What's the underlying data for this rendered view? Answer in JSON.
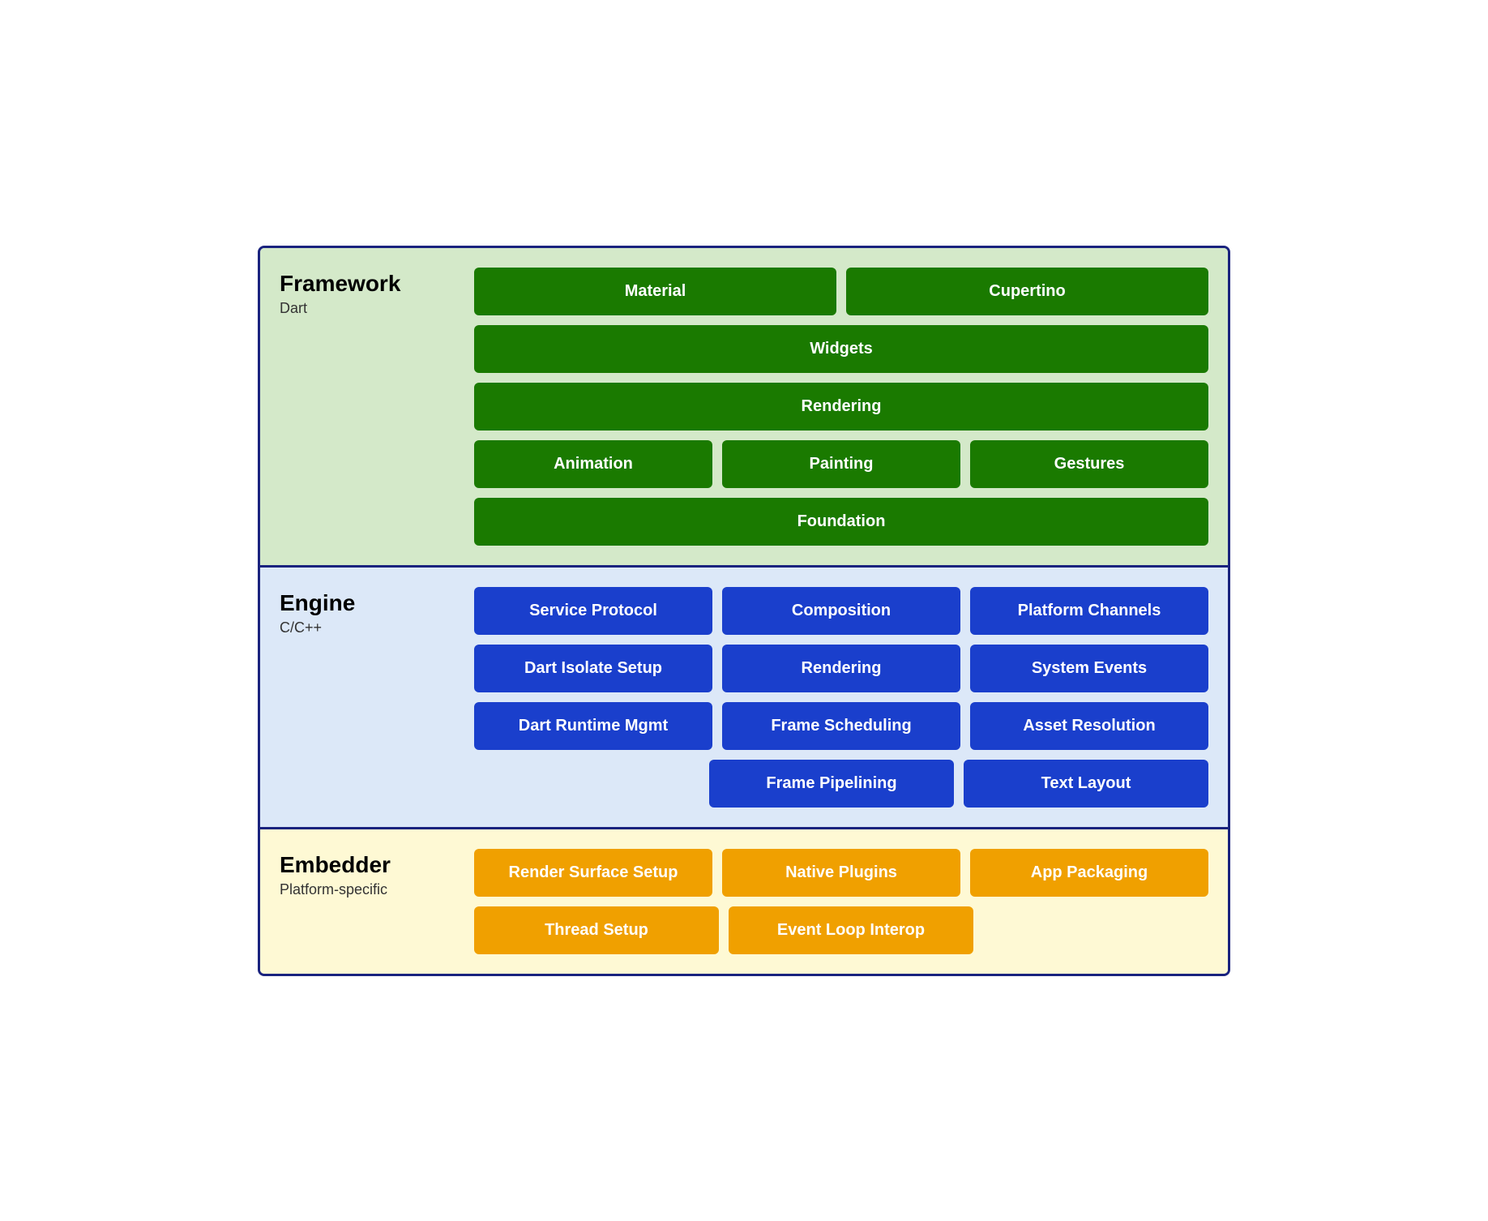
{
  "framework": {
    "title": "Framework",
    "subtitle": "Dart",
    "rows": [
      [
        {
          "label": "Material",
          "flex": 1
        },
        {
          "label": "Cupertino",
          "flex": 1
        }
      ],
      [
        {
          "label": "Widgets",
          "flex": 1
        }
      ],
      [
        {
          "label": "Rendering",
          "flex": 1
        }
      ],
      [
        {
          "label": "Animation",
          "flex": 1
        },
        {
          "label": "Painting",
          "flex": 1
        },
        {
          "label": "Gestures",
          "flex": 1
        }
      ],
      [
        {
          "label": "Foundation",
          "flex": 1
        }
      ]
    ]
  },
  "engine": {
    "title": "Engine",
    "subtitle": "C/C++",
    "rows": [
      [
        {
          "label": "Service Protocol",
          "flex": 1
        },
        {
          "label": "Composition",
          "flex": 1
        },
        {
          "label": "Platform Channels",
          "flex": 1
        }
      ],
      [
        {
          "label": "Dart Isolate Setup",
          "flex": 1
        },
        {
          "label": "Rendering",
          "flex": 1
        },
        {
          "label": "System Events",
          "flex": 1
        }
      ],
      [
        {
          "label": "Dart Runtime Mgmt",
          "flex": 1
        },
        {
          "label": "Frame Scheduling",
          "flex": 1
        },
        {
          "label": "Asset Resolution",
          "flex": 1
        }
      ],
      [
        {
          "label": "",
          "flex": 1,
          "empty": true
        },
        {
          "label": "Frame Pipelining",
          "flex": 1
        },
        {
          "label": "Text Layout",
          "flex": 1
        }
      ]
    ]
  },
  "embedder": {
    "title": "Embedder",
    "subtitle": "Platform-specific",
    "rows": [
      [
        {
          "label": "Render Surface Setup",
          "flex": 1
        },
        {
          "label": "Native Plugins",
          "flex": 1
        },
        {
          "label": "App Packaging",
          "flex": 1
        }
      ],
      [
        {
          "label": "Thread Setup",
          "flex": 1
        },
        {
          "label": "Event Loop Interop",
          "flex": 1
        },
        {
          "label": "",
          "flex": 1,
          "empty": true
        }
      ]
    ]
  }
}
